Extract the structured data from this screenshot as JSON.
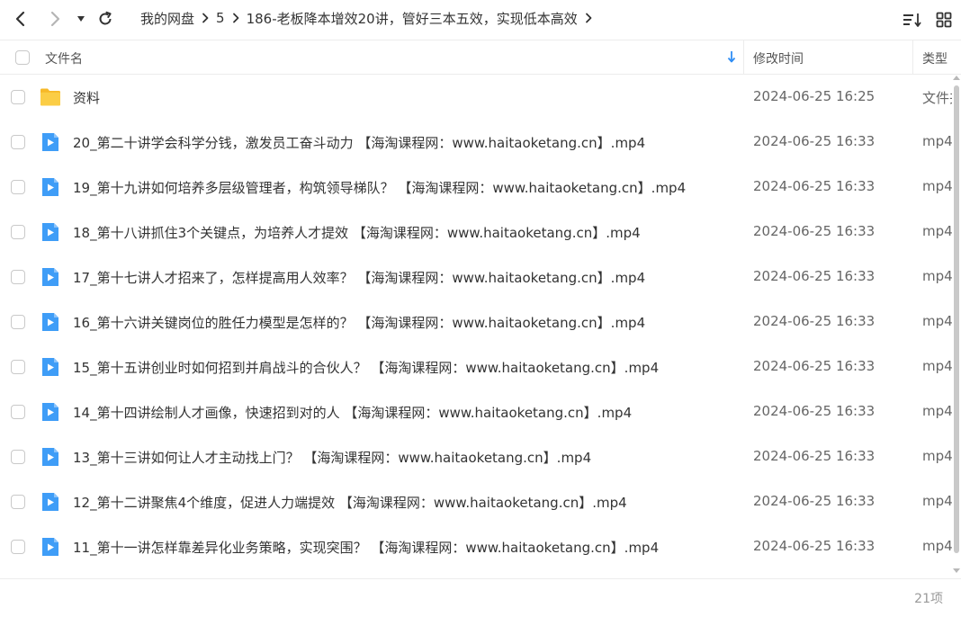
{
  "toolbar": {
    "back_icon": "chevron-left-icon",
    "forward_icon": "chevron-right-icon",
    "history_icon": "caret-down-icon",
    "refresh_icon": "refresh-icon",
    "sort_icon": "sort-icon",
    "view_icon": "grid-view-icon"
  },
  "breadcrumb": {
    "items": [
      "我的网盘",
      "5",
      "186-老板降本增效20讲，管好三本五效，实现低本高效"
    ]
  },
  "columns": {
    "name": "文件名",
    "modified": "修改时间",
    "type": "类型"
  },
  "files": [
    {
      "name": "资料",
      "date": "2024-06-25 16:25",
      "type": "文件夹",
      "icon": "folder-icon"
    },
    {
      "name": "20_第二十讲学会科学分钱，激发员工奋斗动力 【海淘课程网：www.haitaoketang.cn】.mp4",
      "date": "2024-06-25 16:33",
      "type": "mp4",
      "icon": "video-file-icon"
    },
    {
      "name": "19_第十九讲如何培养多层级管理者，构筑领导梯队？ 【海淘课程网：www.haitaoketang.cn】.mp4",
      "date": "2024-06-25 16:33",
      "type": "mp4",
      "icon": "video-file-icon"
    },
    {
      "name": "18_第十八讲抓住3个关键点，为培养人才提效 【海淘课程网：www.haitaoketang.cn】.mp4",
      "date": "2024-06-25 16:33",
      "type": "mp4",
      "icon": "video-file-icon"
    },
    {
      "name": "17_第十七讲人才招来了，怎样提高用人效率？ 【海淘课程网：www.haitaoketang.cn】.mp4",
      "date": "2024-06-25 16:33",
      "type": "mp4",
      "icon": "video-file-icon"
    },
    {
      "name": "16_第十六讲关键岗位的胜任力模型是怎样的？ 【海淘课程网：www.haitaoketang.cn】.mp4",
      "date": "2024-06-25 16:33",
      "type": "mp4",
      "icon": "video-file-icon"
    },
    {
      "name": "15_第十五讲创业时如何招到并肩战斗的合伙人？ 【海淘课程网：www.haitaoketang.cn】.mp4",
      "date": "2024-06-25 16:33",
      "type": "mp4",
      "icon": "video-file-icon"
    },
    {
      "name": "14_第十四讲绘制人才画像，快速招到对的人 【海淘课程网：www.haitaoketang.cn】.mp4",
      "date": "2024-06-25 16:33",
      "type": "mp4",
      "icon": "video-file-icon"
    },
    {
      "name": "13_第十三讲如何让人才主动找上门？ 【海淘课程网：www.haitaoketang.cn】.mp4",
      "date": "2024-06-25 16:33",
      "type": "mp4",
      "icon": "video-file-icon"
    },
    {
      "name": "12_第十二讲聚焦4个维度，促进人力端提效 【海淘课程网：www.haitaoketang.cn】.mp4",
      "date": "2024-06-25 16:33",
      "type": "mp4",
      "icon": "video-file-icon"
    },
    {
      "name": "11_第十一讲怎样靠差异化业务策略，实现突围？ 【海淘课程网：www.haitaoketang.cn】.mp4",
      "date": "2024-06-25 16:33",
      "type": "mp4",
      "icon": "video-file-icon"
    }
  ],
  "footer": {
    "count": "21项"
  },
  "colors": {
    "folder": "#f9c93a",
    "video": "#3f9df7",
    "sort_arrow": "#2f8ef5"
  }
}
